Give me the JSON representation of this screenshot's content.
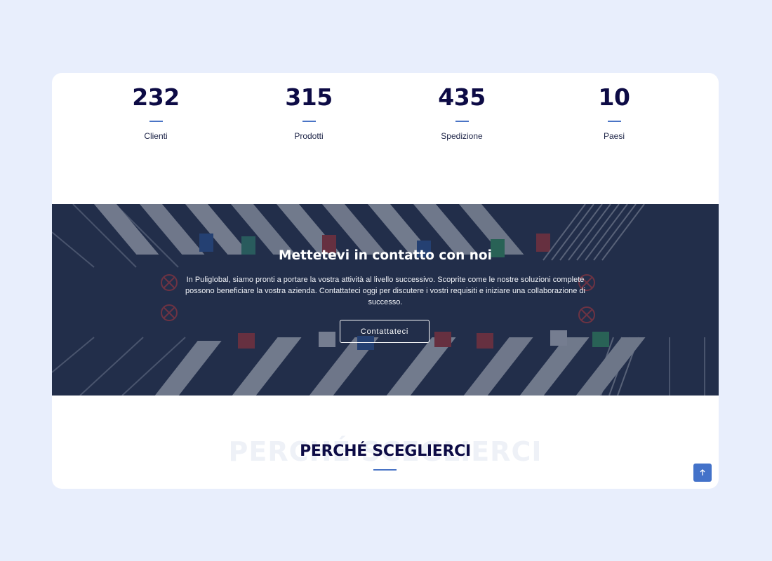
{
  "stats": [
    {
      "number": "232",
      "label": "Clienti"
    },
    {
      "number": "315",
      "label": "Prodotti"
    },
    {
      "number": "435",
      "label": "Spedizione"
    },
    {
      "number": "10",
      "label": "Paesi"
    }
  ],
  "cta": {
    "title": "Mettetevi in contatto con noi",
    "text": "In Puliglobal, siamo pronti a portare la vostra attività al livello successivo. Scoprite come le nostre soluzioni complete possono beneficiare la vostra azienda. Contattateci oggi per discutere i vostri requisiti e iniziare una collaborazione di successo.",
    "button_label": "Contattateci"
  },
  "why": {
    "title": "PERCHÉ SCEGLIERCI",
    "ghost_title": "PERCHÉ SCEGLIERCI"
  },
  "colors": {
    "background": "#e8eefc",
    "heading": "#0d0b45",
    "accent": "#4a74c5"
  },
  "icons": {
    "scroll_top": "arrow-up-icon"
  }
}
